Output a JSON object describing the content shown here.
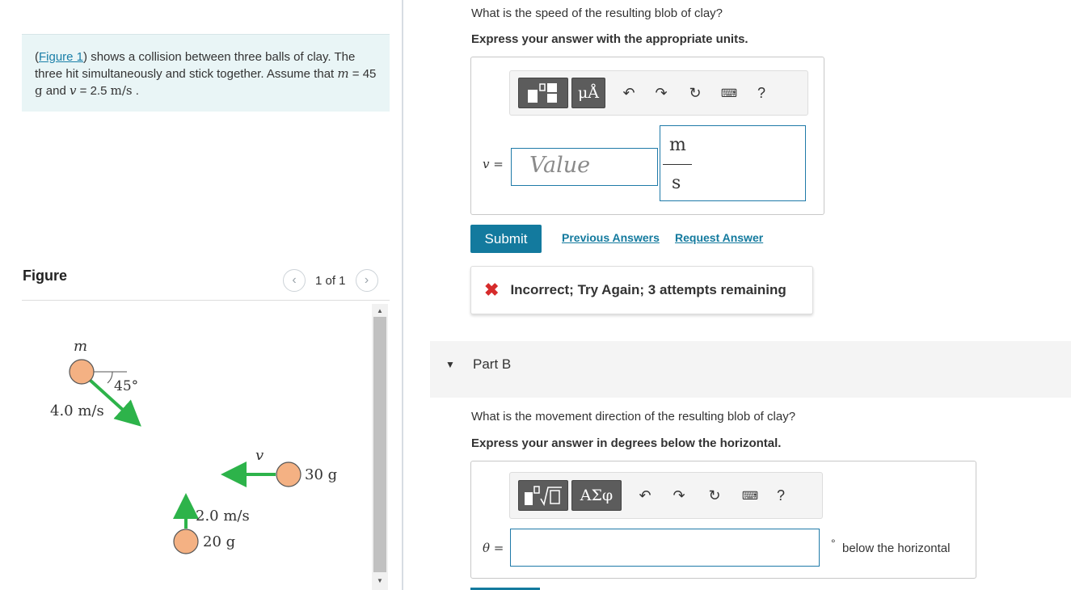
{
  "problem": {
    "figure_link": "Figure 1",
    "text_part1": "shows a collision between three balls of clay. The three hit simultaneously and stick together. Assume that",
    "m_var": "m",
    "m_eq": " = 45 ",
    "m_unit": "g",
    "and": " and ",
    "v_var": "v",
    "v_eq": " = 2.5 ",
    "v_unit": "m/s",
    "end": " ."
  },
  "figure_panel": {
    "title": "Figure",
    "pager": "1 of 1",
    "labels": {
      "m": "m",
      "angle": "45°",
      "speed1": "4.0 m/s",
      "v": "v",
      "mass2": "30 g",
      "speed3": "2.0 m/s",
      "mass3": "20 g"
    }
  },
  "part_a": {
    "question": "What is the speed of the resulting blob of clay?",
    "instruction": "Express your answer with the appropriate units.",
    "var_label": "v =",
    "placeholder": "Value",
    "unit_num": "m",
    "unit_den": "s",
    "toolbar_units_label": "μÅ",
    "help": "?",
    "submit": "Submit",
    "previous_answers": "Previous Answers",
    "request_answer": "Request Answer",
    "feedback": "Incorrect; Try Again; 3 attempts remaining"
  },
  "part_b": {
    "label": "Part B",
    "question": "What is the movement direction of the resulting blob of clay?",
    "instruction": "Express your answer in degrees below the horizontal.",
    "var_label": "θ =",
    "toolbar_symbols_label": "ΑΣφ",
    "help": "?",
    "degree_symbol": "°",
    "suffix": "below the horizontal"
  },
  "colors": {
    "link": "#137a9e",
    "submit_bg": "#137a9e",
    "error": "#d62b2b",
    "arrow": "#2db34a",
    "ball": "#f4b183"
  }
}
